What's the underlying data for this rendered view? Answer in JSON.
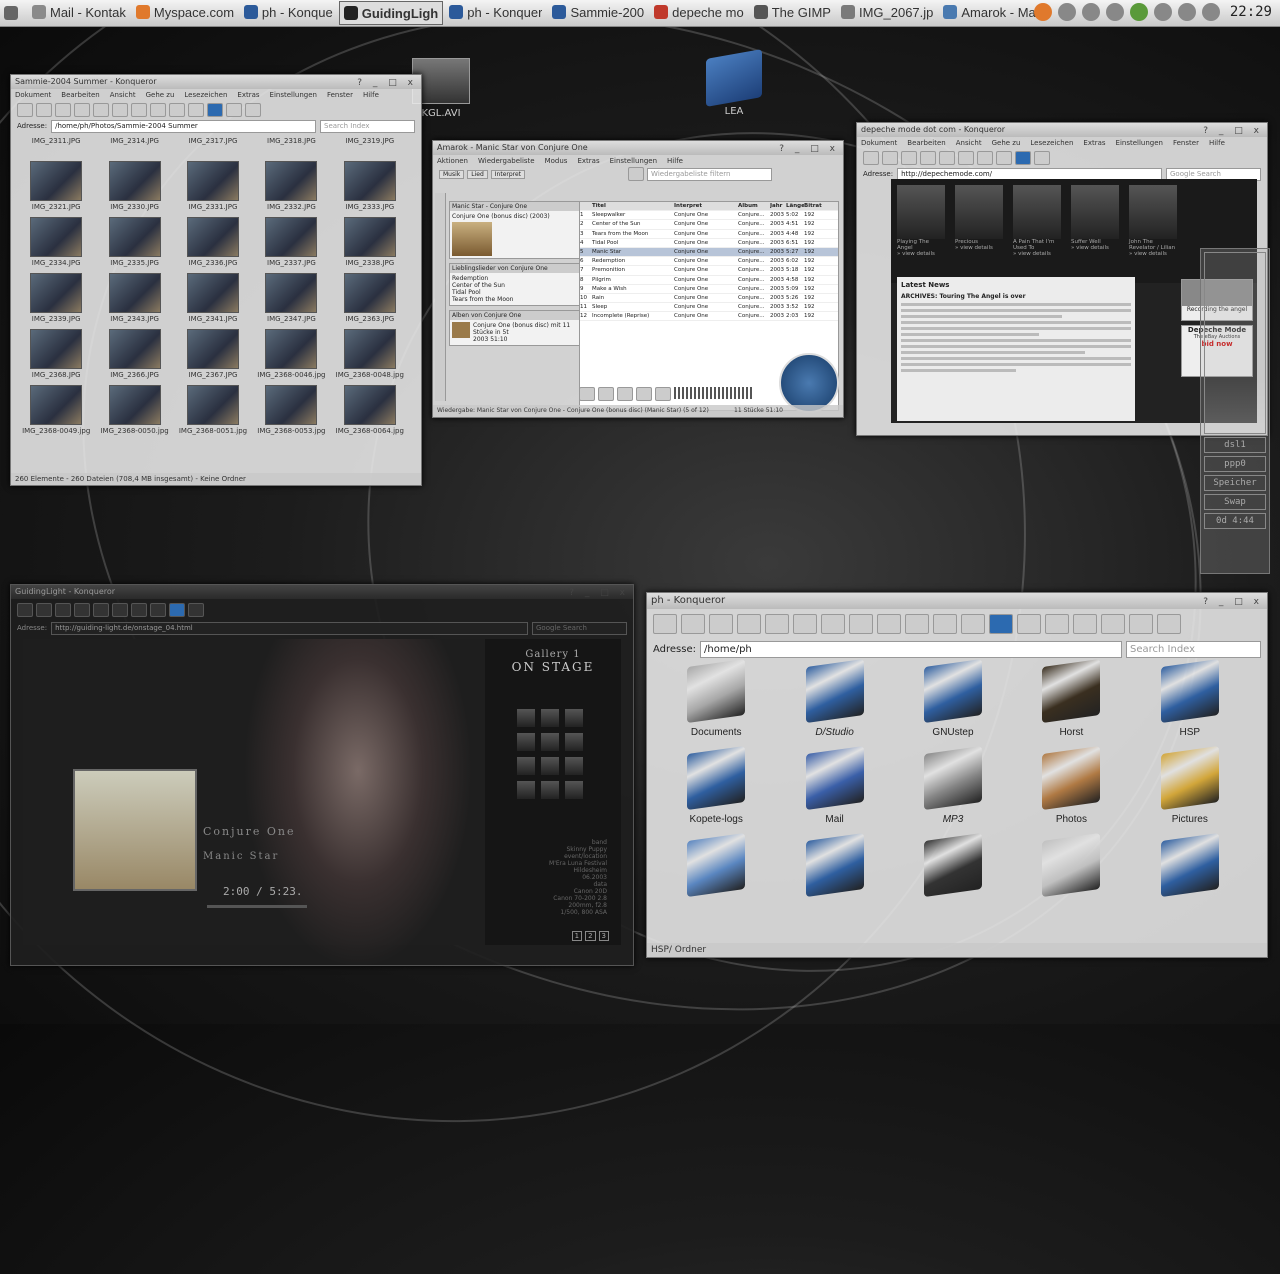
{
  "taskbar": {
    "tasks": [
      {
        "label": "Mail - Kontak",
        "color": "#8a8a8a"
      },
      {
        "label": "Myspace.com",
        "color": "#e0792c"
      },
      {
        "label": "ph - Konque",
        "color": "#2c5a9a"
      },
      {
        "label": "GuidingLigh",
        "color": "#222222",
        "active": true
      },
      {
        "label": "ph - Konquer",
        "color": "#2c5a9a"
      },
      {
        "label": "Sammie-200",
        "color": "#2c5a9a"
      },
      {
        "label": "depeche mo",
        "color": "#c0392b"
      },
      {
        "label": "The GIMP",
        "color": "#555555"
      },
      {
        "label": "IMG_2067.jp",
        "color": "#7a7a7a"
      },
      {
        "label": "Amarok - Ma",
        "color": "#4a7ab0"
      }
    ],
    "clock": "22:29"
  },
  "desktop_icons": [
    {
      "label": "KGL.AVI",
      "kind": "video"
    },
    {
      "label": "LEA",
      "kind": "folder"
    }
  ],
  "win_sammie": {
    "title": "Sammie-2004 Summer - Konqueror",
    "menu": [
      "Dokument",
      "Bearbeiten",
      "Ansicht",
      "Gehe zu",
      "Lesezeichen",
      "Extras",
      "Einstellungen",
      "Fenster",
      "Hilfe"
    ],
    "address_label": "Adresse:",
    "address": "/home/ph/Photos/Sammie-2004 Summer",
    "search_placeholder": "Search Index",
    "top_labels": [
      "IMG_2311.JPG",
      "IMG_2314.JPG",
      "IMG_2317.JPG",
      "IMG_2318.JPG",
      "IMG_2319.JPG"
    ],
    "thumbs": [
      "IMG_2321.JPG",
      "IMG_2330.JPG",
      "IMG_2331.JPG",
      "IMG_2332.JPG",
      "IMG_2333.JPG",
      "IMG_2334.JPG",
      "IMG_2335.JPG",
      "IMG_2336.JPG",
      "IMG_2337.JPG",
      "IMG_2338.JPG",
      "IMG_2339.JPG",
      "IMG_2343.JPG",
      "IMG_2341.JPG",
      "IMG_2347.JPG",
      "IMG_2363.JPG",
      "IMG_2368.JPG",
      "IMG_2366.JPG",
      "IMG_2367.JPG",
      "IMG_2368-0046.jpg",
      "IMG_2368-0048.jpg",
      "IMG_2368-0049.jpg",
      "IMG_2368-0050.jpg",
      "IMG_2368-0051.jpg",
      "IMG_2368-0053.jpg",
      "IMG_2368-0064.jpg"
    ],
    "status": "260 Elemente - 260 Dateien (708,4 MB insgesamt) - Keine Ordner"
  },
  "win_amarok": {
    "title": "Amarok - Manic Star von Conjure One",
    "menu": [
      "Aktionen",
      "Wiedergabeliste",
      "Modus",
      "Extras",
      "Einstellungen",
      "Hilfe"
    ],
    "tabs": [
      "Musik",
      "Lied",
      "Interpret"
    ],
    "filter_placeholder": "Wiedergabeliste filtern",
    "now_playing_header": "Manic Star - Conjure One",
    "now_playing_sub": "Conjure One (bonus disc) (2003)",
    "context_header2": "Lieblingslieder von Conjure One",
    "fav_tracks": [
      "Redemption",
      "Center of the Sun",
      "Tidal Pool",
      "Tears from the Moon"
    ],
    "context_header3": "Alben von Conjure One",
    "album_text": "Conjure One (bonus disc) mit 11 Stücke in 5t",
    "album_year": "2003",
    "album_time": "51:10",
    "columns": [
      "Titel",
      "Interpret",
      "Album",
      "Jahr",
      "Länge",
      "Bitrate"
    ],
    "tracks": [
      {
        "n": "1",
        "title": "Sleepwalker",
        "artist": "Conjure One",
        "album": "Conjure...",
        "year": "2003",
        "len": "5:02",
        "br": "192"
      },
      {
        "n": "2",
        "title": "Center of the Sun",
        "artist": "Conjure One",
        "album": "Conjure...",
        "year": "2003",
        "len": "4:51",
        "br": "192"
      },
      {
        "n": "3",
        "title": "Tears from the Moon",
        "artist": "Conjure One",
        "album": "Conjure...",
        "year": "2003",
        "len": "4:48",
        "br": "192"
      },
      {
        "n": "4",
        "title": "Tidal Pool",
        "artist": "Conjure One",
        "album": "Conjure...",
        "year": "2003",
        "len": "6:51",
        "br": "192"
      },
      {
        "n": "5",
        "title": "Manic Star",
        "artist": "Conjure One",
        "album": "Conjure...",
        "year": "2003",
        "len": "5:27",
        "br": "192",
        "sel": true
      },
      {
        "n": "6",
        "title": "Redemption",
        "artist": "Conjure One",
        "album": "Conjure...",
        "year": "2003",
        "len": "6:02",
        "br": "192"
      },
      {
        "n": "7",
        "title": "Premonition",
        "artist": "Conjure One",
        "album": "Conjure...",
        "year": "2003",
        "len": "5:18",
        "br": "192"
      },
      {
        "n": "8",
        "title": "Pilgrim",
        "artist": "Conjure One",
        "album": "Conjure...",
        "year": "2003",
        "len": "4:58",
        "br": "192"
      },
      {
        "n": "9",
        "title": "Make a Wish",
        "artist": "Conjure One",
        "album": "Conjure...",
        "year": "2003",
        "len": "5:09",
        "br": "192"
      },
      {
        "n": "10",
        "title": "Rain",
        "artist": "Conjure One",
        "album": "Conjure...",
        "year": "2003",
        "len": "5:26",
        "br": "192"
      },
      {
        "n": "11",
        "title": "Sleep",
        "artist": "Conjure One",
        "album": "Conjure...",
        "year": "2003",
        "len": "3:52",
        "br": "192"
      },
      {
        "n": "12",
        "title": "Incomplete (Reprise)",
        "artist": "Conjure One",
        "album": "Conjure...",
        "year": "2003",
        "len": "2:03",
        "br": "192"
      }
    ],
    "status": "Wiedergabe: Manic Star von Conjure One - Conjure One (bonus disc) (Manic Star) (5 of 12)",
    "status_right": "11 Stücke  51:10"
  },
  "win_depeche": {
    "title": "depeche mode dot com - Konqueror",
    "menu": [
      "Dokument",
      "Bearbeiten",
      "Ansicht",
      "Gehe zu",
      "Lesezeichen",
      "Extras",
      "Einstellungen",
      "Fenster",
      "Hilfe"
    ],
    "address_label": "Adresse:",
    "address": "http://depechemode.com/",
    "search_placeholder": "Google Search",
    "strip": [
      {
        "caption": "Playing The Angel",
        "sub": "» view details"
      },
      {
        "caption": "Precious",
        "sub": "» view details"
      },
      {
        "caption": "A Pain That I'm Used To",
        "sub": "» view details"
      },
      {
        "caption": "Suffer Well",
        "sub": "» view details"
      },
      {
        "caption": "John The Revelator / Lilian",
        "sub": "» view details"
      }
    ],
    "news_title": "Latest News",
    "news_first": "ARCHIVES: Touring The Angel is over",
    "ad1": "Recording the angel",
    "ad2_title": "Depeche Mode",
    "ad2_sub": "The eBay Auctions",
    "ad2_cta": "bid now"
  },
  "win_guiding": {
    "title": "GuidingLight - Konqueror",
    "address_label": "Adresse:",
    "address": "http://guiding-light.de/onstage_04.html",
    "search_placeholder": "Google Search",
    "gallery_label": "Gallery 1",
    "gallery_title": "ON STAGE",
    "artist": "Conjure One",
    "song": "Manic Star",
    "time_now": "2:00",
    "time_sep": "/",
    "time_total": "5:23.",
    "meta_lines": [
      "band",
      "Skinny Puppy",
      "event/location",
      "M'Era Luna Festival",
      "Hildesheim",
      "06.2003",
      "data",
      "Canon 20D",
      "Canon 70-200 2.8",
      "200mm, f2.8",
      "1/500, 800 ASA"
    ],
    "pages": [
      "1",
      "2",
      "3"
    ]
  },
  "win_ph": {
    "title": "ph - Konqueror",
    "address_label": "Adresse:",
    "address": "/home/ph",
    "search_placeholder": "Search Index",
    "folders": [
      {
        "label": "Documents",
        "color": "#a8a8a8"
      },
      {
        "label": "D/Studio",
        "color": "#2f5fa0",
        "italic": true
      },
      {
        "label": "GNUstep",
        "color": "#2f5fa0"
      },
      {
        "label": "Horst",
        "color": "#3a2f20"
      },
      {
        "label": "HSP",
        "color": "#2f5fa0"
      },
      {
        "label": "Kopete-logs",
        "color": "#2f5fa0"
      },
      {
        "label": "Mail",
        "color": "#3a5fa8"
      },
      {
        "label": "MP3",
        "color": "#888888",
        "italic": true
      },
      {
        "label": "Photos",
        "color": "#b07a44"
      },
      {
        "label": "Pictures",
        "color": "#d2a63a"
      },
      {
        "label": "",
        "color": "#5a86c0"
      },
      {
        "label": "",
        "color": "#2f5fa0"
      },
      {
        "label": "",
        "color": "#333333"
      },
      {
        "label": "",
        "color": "#c0c0c0"
      },
      {
        "label": "",
        "color": "#2f5fa0"
      }
    ],
    "status": "HSP/  Ordner"
  },
  "monitor": {
    "cells": [
      "dsl1",
      "ppp0",
      "Speicher",
      "Swap",
      "0d  4:44"
    ]
  }
}
